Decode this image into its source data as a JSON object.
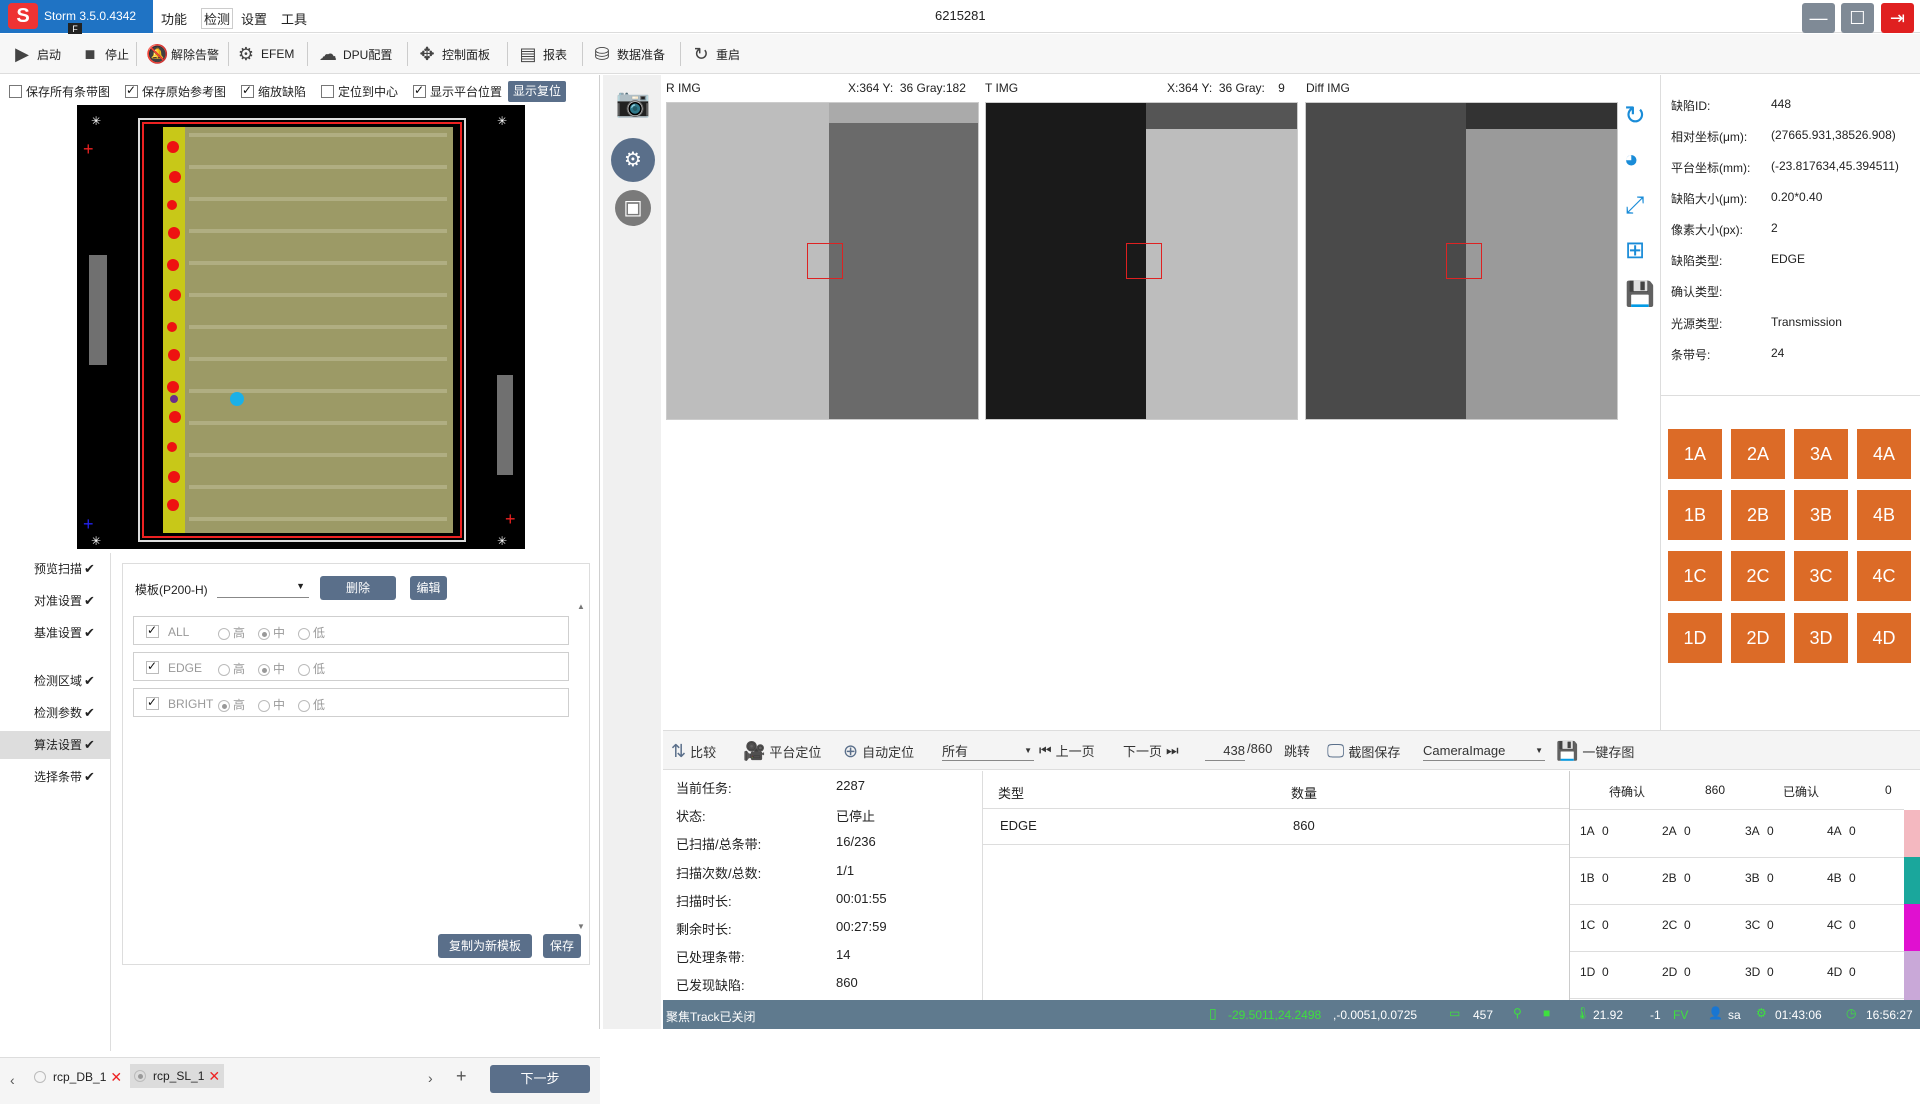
{
  "app": {
    "name": "Storm 3.5.0.4342",
    "badge": "F",
    "window_title": "6215281"
  },
  "menu": [
    "功能",
    "检测",
    "设置",
    "工具"
  ],
  "toolbar": [
    {
      "label": "启动",
      "icon": "play-icon"
    },
    {
      "label": "停止",
      "icon": "stop-icon"
    },
    {
      "label": "解除告警",
      "icon": "bell-off-icon"
    },
    {
      "label": "EFEM",
      "icon": "robot-arm-icon"
    },
    {
      "label": "DPU配置",
      "icon": "cloud-gear-icon"
    },
    {
      "label": "控制面板",
      "icon": "move-arrows-icon"
    },
    {
      "label": "报表",
      "icon": "report-icon"
    },
    {
      "label": "数据准备",
      "icon": "database-icon"
    },
    {
      "label": "重启",
      "icon": "restart-icon"
    }
  ],
  "options": [
    {
      "label": "保存所有条带图",
      "checked": false
    },
    {
      "label": "保存原始参考图",
      "checked": true
    },
    {
      "label": "缩放缺陷",
      "checked": true
    },
    {
      "label": "定位到中心",
      "checked": false
    },
    {
      "label": "显示平台位置",
      "checked": true
    }
  ],
  "show_reset_label": "显示复位",
  "nav": [
    {
      "label": "预览扫描",
      "done": "✔"
    },
    {
      "label": "对准设置",
      "done": "✔"
    },
    {
      "label": "基准设置",
      "done": "✔"
    },
    {
      "label": "检测区域",
      "done": "✔"
    },
    {
      "label": "检测参数",
      "done": "✔"
    },
    {
      "label": "算法设置",
      "done": "✔"
    },
    {
      "label": "选择条带",
      "done": "✔"
    }
  ],
  "template": {
    "label": "模板(P200-H)",
    "delete_label": "删除",
    "edit_label": "编辑",
    "rows": [
      {
        "name": "ALL",
        "levels": [
          "高",
          "中",
          "低"
        ],
        "selected": 1
      },
      {
        "name": "EDGE",
        "levels": [
          "高",
          "中",
          "低"
        ],
        "selected": 1
      },
      {
        "name": "BRIGHT",
        "levels": [
          "高",
          "中",
          "低"
        ],
        "selected": 0
      }
    ],
    "copy_label": "复制为新模板",
    "save_label": "保存"
  },
  "tabs": [
    {
      "label": "rcp_DB_1"
    },
    {
      "label": "rcp_SL_1"
    }
  ],
  "next_label": "下一步",
  "images": [
    {
      "title": "R IMG",
      "readout": "X:364 Y:  36 Gray:182"
    },
    {
      "title": "T IMG",
      "readout": "X:364 Y:  36 Gray:    9"
    },
    {
      "title": "Diff IMG",
      "readout": ""
    }
  ],
  "defect_info": [
    {
      "label": "缺陷ID:",
      "value": "448"
    },
    {
      "label": "相对坐标(μm):",
      "value": "(27665.931,38526.908)"
    },
    {
      "label": "平台坐标(mm):",
      "value": "(-23.817634,45.394511)"
    },
    {
      "label": "缺陷大小(μm):",
      "value": "0.20*0.40"
    },
    {
      "label": "像素大小(px):",
      "value": "2"
    },
    {
      "label": "缺陷类型:",
      "value": "EDGE"
    },
    {
      "label": "确认类型:",
      "value": ""
    },
    {
      "label": "光源类型:",
      "value": "Transmission"
    },
    {
      "label": "条带号:",
      "value": "24"
    }
  ],
  "grade_buttons": [
    "1A",
    "2A",
    "3A",
    "4A",
    "1B",
    "2B",
    "3B",
    "4B",
    "1C",
    "2C",
    "3C",
    "4C",
    "1D",
    "2D",
    "3D",
    "4D"
  ],
  "controls": {
    "compare": "比较",
    "stage_locate": "平台定位",
    "auto_locate": "自动定位",
    "filter": "所有",
    "prev": "上一页",
    "next": "下一页",
    "page": "438",
    "total": "/860",
    "jump": "跳转",
    "screenshot": "截图保存",
    "camera": "CameraImage",
    "onekey": "一键存图"
  },
  "task": [
    {
      "label": "当前任务:",
      "value": "2287"
    },
    {
      "label": "状态:",
      "value": "已停止"
    },
    {
      "label": "已扫描/总条带:",
      "value": "16/236"
    },
    {
      "label": "扫描次数/总数:",
      "value": "1/1"
    },
    {
      "label": "扫描时长:",
      "value": "00:01:55"
    },
    {
      "label": "剩余时长:",
      "value": "00:27:59"
    },
    {
      "label": "已处理条带:",
      "value": "14"
    },
    {
      "label": "已发现缺陷:",
      "value": "860"
    }
  ],
  "types_table": {
    "headers": [
      "类型",
      "数量"
    ],
    "rows": [
      [
        "EDGE",
        "860"
      ]
    ]
  },
  "confirm": {
    "pending_label": "待确认",
    "pending": "860",
    "confirmed_label": "已确认",
    "confirmed": "0"
  },
  "grade_counts": [
    [
      [
        "1A",
        "0"
      ],
      [
        "2A",
        "0"
      ],
      [
        "3A",
        "0"
      ],
      [
        "4A",
        "0"
      ]
    ],
    [
      [
        "1B",
        "0"
      ],
      [
        "2B",
        "0"
      ],
      [
        "3B",
        "0"
      ],
      [
        "4B",
        "0"
      ]
    ],
    [
      [
        "1C",
        "0"
      ],
      [
        "2C",
        "0"
      ],
      [
        "3C",
        "0"
      ],
      [
        "4C",
        "0"
      ]
    ],
    [
      [
        "1D",
        "0"
      ],
      [
        "2D",
        "0"
      ],
      [
        "3D",
        "0"
      ],
      [
        "4D",
        "0"
      ]
    ]
  ],
  "row_colors": [
    "#f4b8c0",
    "#1aa79c",
    "#e010d0",
    "#c9a8d8"
  ],
  "status": {
    "message": "聚焦Track已关闭",
    "coord_green": "-29.5011,24.2498",
    "coord": ",-0.0051,0.0725",
    "count": "457",
    "temp": "21.92",
    "minus": "-1",
    "fv": "FV",
    "user": "sa",
    "elapsed": "01:43:06",
    "clock": "16:56:27"
  },
  "colors": {
    "accent": "#1f73c4",
    "grade": "#dc6b27",
    "status": "#5f7a8e"
  }
}
